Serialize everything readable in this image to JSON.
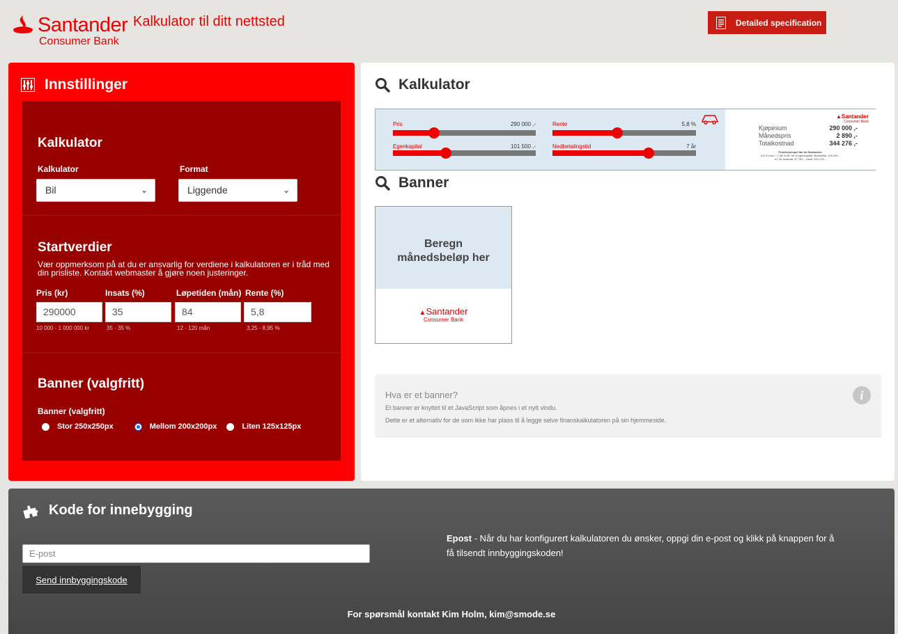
{
  "header": {
    "brand_name": "Santander",
    "brand_sub": "Consumer Bank",
    "tagline": "Kalkulator til ditt nettsted",
    "spec_button": "Detailed specification",
    "brand_color": "#ec0000"
  },
  "settings": {
    "title": "Innstillinger",
    "calc_section": {
      "title": "Kalkulator",
      "calc_label": "Kalkulator",
      "calc_value": "Bil",
      "format_label": "Format",
      "format_value": "Liggende"
    },
    "start_section": {
      "title": "Startverdier",
      "description": "Vær oppmerksom på at du er ansvarlig for verdiene i kalkulatoren er i tråd med din prisliste. Kontakt webmaster å gjøre noen justeringer.",
      "fields": [
        {
          "label": "Pris (kr)",
          "value": "290000",
          "hint": "10 000 - 1 000 000 kr"
        },
        {
          "label": "Insats (%)",
          "value": "35",
          "hint": "35 - 35 %"
        },
        {
          "label": "Løpetiden (mån)",
          "value": "84",
          "hint": "12 - 120 mån"
        },
        {
          "label": "Rente (%)",
          "value": "5,8",
          "hint": "3,25 - 8,95 %"
        }
      ]
    },
    "banner_section": {
      "title": "Banner (valgfritt)",
      "label": "Banner (valgfritt)",
      "options": [
        "Stor 250x250px",
        "Mellom 200x200px",
        "Liten 125x125px"
      ],
      "selected": "Mellom 200x200px"
    }
  },
  "preview": {
    "calc_title": "Kalkulator",
    "banner_title": "Banner",
    "sliders": [
      {
        "label": "Pris",
        "value": "290 000 ,-",
        "level": 0.29
      },
      {
        "label": "Egenkapital",
        "value": "101 500 ,-",
        "level": 0.37
      },
      {
        "label": "Rente",
        "value": "5,8 %",
        "level": 0.45
      },
      {
        "label": "Nedbetalingstid",
        "value": "7 år",
        "level": 0.67
      }
    ],
    "summary": [
      {
        "label": "Kjøpesum",
        "value": "290 000 ,-"
      },
      {
        "label": "Månedspris",
        "value": "2 890 ,-"
      },
      {
        "label": "Totalkostnad",
        "value": "344 276 ,-"
      }
    ],
    "fine_print_title": "Prisekesempel lån fra Santander:",
    "fine_print_1": "5,8 % nom. / 7.48 % eff. 35 % egenkapital, lånebeløp: 193 290 ,-",
    "fine_print_2": "o/7 år, kostnad: 57 760 ,- totalt: 344 276 ,-",
    "banner_text_1": "Beregn",
    "banner_text_2": "månedsbeløp her",
    "info_title": "Hva er et banner?",
    "info_line_1": "Et banner er knyttet til et JavaScript som åpnes i et nytt vindu.",
    "info_line_2": "Dette er et alternativ for de som ikke har plass til å legge selve finanskalkulatoren på sin hjemmeside."
  },
  "embed": {
    "title": "Kode for innebygging",
    "email_placeholder": "E-post",
    "send_button": "Send innbyggingskode",
    "epost_bold": "Epost",
    "epost_text": " - Når du har konfigurert kalkulatoren du ønsker, oppgi din e-post og klikk på knappen for å få tilsendt innbyggingskoden!",
    "contact": "For spørsmål kontakt Kim Holm, kim@smode.se"
  }
}
